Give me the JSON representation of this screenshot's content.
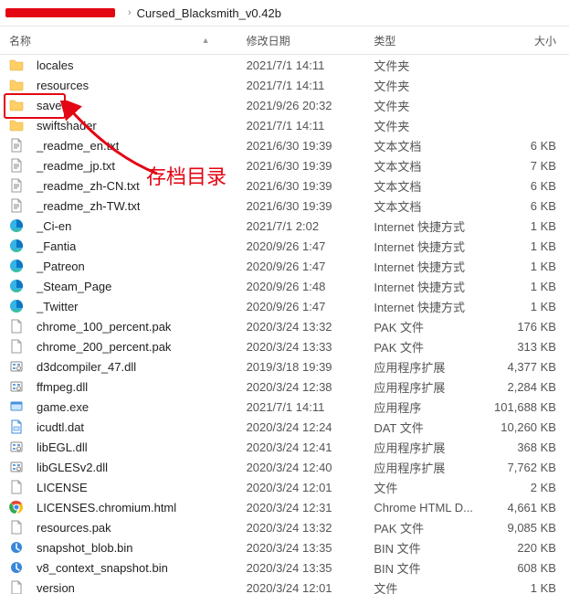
{
  "breadcrumb": {
    "current": "Cursed_Blacksmith_v0.42b"
  },
  "columns": {
    "name": "名称",
    "date": "修改日期",
    "type": "类型",
    "size": "大小"
  },
  "annotation_text": "存档目录",
  "files": [
    {
      "icon": "folder",
      "name": "locales",
      "date": "2021/7/1 14:11",
      "type": "文件夹",
      "size": ""
    },
    {
      "icon": "folder",
      "name": "resources",
      "date": "2021/7/1 14:11",
      "type": "文件夹",
      "size": ""
    },
    {
      "icon": "folder",
      "name": "save",
      "date": "2021/9/26 20:32",
      "type": "文件夹",
      "size": "",
      "highlighted": true
    },
    {
      "icon": "folder",
      "name": "swiftshader",
      "date": "2021/7/1 14:11",
      "type": "文件夹",
      "size": ""
    },
    {
      "icon": "text",
      "name": "_readme_en.txt",
      "date": "2021/6/30 19:39",
      "type": "文本文档",
      "size": "6 KB"
    },
    {
      "icon": "text",
      "name": "_readme_jp.txt",
      "date": "2021/6/30 19:39",
      "type": "文本文档",
      "size": "7 KB"
    },
    {
      "icon": "text",
      "name": "_readme_zh-CN.txt",
      "date": "2021/6/30 19:39",
      "type": "文本文档",
      "size": "6 KB"
    },
    {
      "icon": "text",
      "name": "_readme_zh-TW.txt",
      "date": "2021/6/30 19:39",
      "type": "文本文档",
      "size": "6 KB"
    },
    {
      "icon": "edge",
      "name": "_Ci-en",
      "date": "2021/7/1 2:02",
      "type": "Internet 快捷方式",
      "size": "1 KB"
    },
    {
      "icon": "edge",
      "name": "_Fantia",
      "date": "2020/9/26 1:47",
      "type": "Internet 快捷方式",
      "size": "1 KB"
    },
    {
      "icon": "edge",
      "name": "_Patreon",
      "date": "2020/9/26 1:47",
      "type": "Internet 快捷方式",
      "size": "1 KB"
    },
    {
      "icon": "edge",
      "name": "_Steam_Page",
      "date": "2020/9/26 1:48",
      "type": "Internet 快捷方式",
      "size": "1 KB"
    },
    {
      "icon": "edge",
      "name": "_Twitter",
      "date": "2020/9/26 1:47",
      "type": "Internet 快捷方式",
      "size": "1 KB"
    },
    {
      "icon": "file",
      "name": "chrome_100_percent.pak",
      "date": "2020/3/24 13:32",
      "type": "PAK 文件",
      "size": "176 KB"
    },
    {
      "icon": "file",
      "name": "chrome_200_percent.pak",
      "date": "2020/3/24 13:33",
      "type": "PAK 文件",
      "size": "313 KB"
    },
    {
      "icon": "dll",
      "name": "d3dcompiler_47.dll",
      "date": "2019/3/18 19:39",
      "type": "应用程序扩展",
      "size": "4,377 KB"
    },
    {
      "icon": "dll",
      "name": "ffmpeg.dll",
      "date": "2020/3/24 12:38",
      "type": "应用程序扩展",
      "size": "2,284 KB"
    },
    {
      "icon": "exe",
      "name": "game.exe",
      "date": "2021/7/1 14:11",
      "type": "应用程序",
      "size": "101,688 KB"
    },
    {
      "icon": "dat",
      "name": "icudtl.dat",
      "date": "2020/3/24 12:24",
      "type": "DAT 文件",
      "size": "10,260 KB"
    },
    {
      "icon": "dll",
      "name": "libEGL.dll",
      "date": "2020/3/24 12:41",
      "type": "应用程序扩展",
      "size": "368 KB"
    },
    {
      "icon": "dll",
      "name": "libGLESv2.dll",
      "date": "2020/3/24 12:40",
      "type": "应用程序扩展",
      "size": "7,762 KB"
    },
    {
      "icon": "file",
      "name": "LICENSE",
      "date": "2020/3/24 12:01",
      "type": "文件",
      "size": "2 KB"
    },
    {
      "icon": "chrome",
      "name": "LICENSES.chromium.html",
      "date": "2020/3/24 12:31",
      "type": "Chrome HTML D...",
      "size": "4,661 KB"
    },
    {
      "icon": "file",
      "name": "resources.pak",
      "date": "2020/3/24 13:32",
      "type": "PAK 文件",
      "size": "9,085 KB"
    },
    {
      "icon": "bin",
      "name": "snapshot_blob.bin",
      "date": "2020/3/24 13:35",
      "type": "BIN 文件",
      "size": "220 KB"
    },
    {
      "icon": "bin",
      "name": "v8_context_snapshot.bin",
      "date": "2020/3/24 13:35",
      "type": "BIN 文件",
      "size": "608 KB"
    },
    {
      "icon": "file",
      "name": "version",
      "date": "2020/3/24 12:01",
      "type": "文件",
      "size": "1 KB"
    }
  ]
}
